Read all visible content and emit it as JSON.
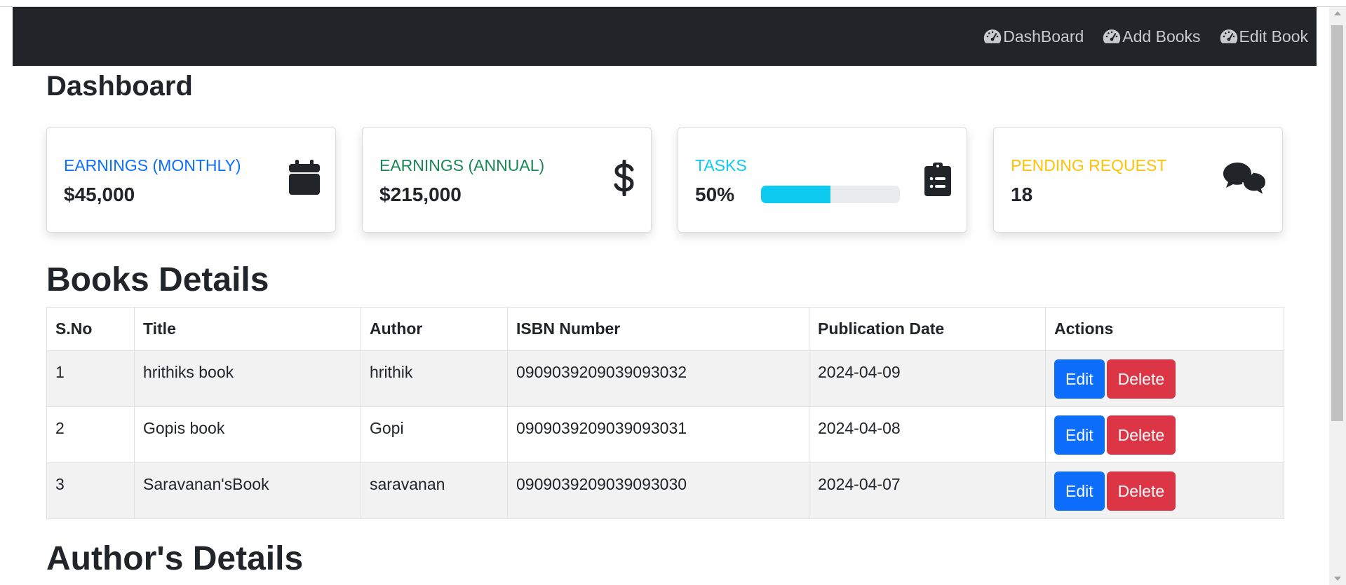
{
  "navbar": {
    "links": [
      {
        "label": "DashBoard",
        "icon": "gauge-icon"
      },
      {
        "label": "Add Books",
        "icon": "gauge-icon"
      },
      {
        "label": "Edit Book",
        "icon": "gauge-icon"
      }
    ]
  },
  "page_title": "Dashboard",
  "cards": [
    {
      "label": "EARNINGS (MONTHLY)",
      "value": "$45,000",
      "color": "#0d6efd",
      "icon": "calendar-icon"
    },
    {
      "label": "EARNINGS (ANNUAL)",
      "value": "$215,000",
      "color": "#198754",
      "icon": "dollar-icon"
    },
    {
      "label": "TASKS",
      "value": "50%",
      "color": "#0dcaf0",
      "icon": "clipboard-list-icon",
      "progress": 0.5
    },
    {
      "label": "PENDING REQUEST",
      "value": "18",
      "color": "#ffc107",
      "icon": "comments-icon"
    }
  ],
  "books_section": {
    "title": "Books Details",
    "columns": [
      "S.No",
      "Title",
      "Author",
      "ISBN Number",
      "Publication Date",
      "Actions"
    ],
    "rows": [
      {
        "sno": "1",
        "title": "hrithiks book",
        "author": "hrithik",
        "isbn": "0909039209039093032",
        "date": "2024-04-09"
      },
      {
        "sno": "2",
        "title": "Gopis book",
        "author": "Gopi",
        "isbn": "0909039209039093031",
        "date": "2024-04-08"
      },
      {
        "sno": "3",
        "title": "Saravanan'sBook",
        "author": "saravanan",
        "isbn": "0909039209039093030",
        "date": "2024-04-07"
      }
    ],
    "edit_label": "Edit",
    "delete_label": "Delete"
  },
  "authors_section": {
    "title": "Author's Details"
  },
  "colors": {
    "navbar": "#212529",
    "edit": "#0d6efd",
    "delete": "#dc3545"
  }
}
